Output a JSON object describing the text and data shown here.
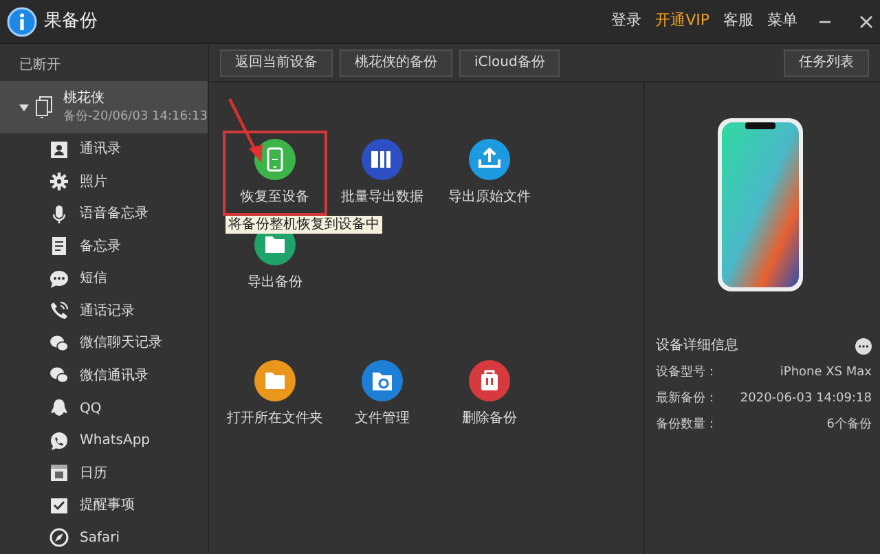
{
  "app": {
    "title": "果备份"
  },
  "header_links": [
    {
      "label": "登录",
      "highlighted": false
    },
    {
      "label": "开通VIP",
      "highlighted": true
    },
    {
      "label": "客服",
      "highlighted": false
    },
    {
      "label": "菜单",
      "highlighted": false
    }
  ],
  "toolbar": {
    "buttons": [
      "返回当前设备",
      "桃花侠的备份",
      "iCloud备份"
    ],
    "task_button": "任务列表"
  },
  "sidebar": {
    "status": "已断开",
    "device": {
      "name": "桃花侠",
      "subtitle": "备份-20/06/03 14:16:13",
      "selected": true,
      "expanded": true
    },
    "items": [
      {
        "label": "通讯录",
        "kind": "contacts"
      },
      {
        "label": "照片",
        "kind": "photos"
      },
      {
        "label": "语音备忘录",
        "kind": "mic"
      },
      {
        "label": "备忘录",
        "kind": "notes"
      },
      {
        "label": "短信",
        "kind": "chat"
      },
      {
        "label": "通话记录",
        "kind": "phone"
      },
      {
        "label": "微信聊天记录",
        "kind": "wechat"
      },
      {
        "label": "微信通讯录",
        "kind": "wechat"
      },
      {
        "label": "QQ",
        "kind": "qq"
      },
      {
        "label": "WhatsApp",
        "kind": "whatsapp"
      },
      {
        "label": "日历",
        "kind": "calendar"
      },
      {
        "label": "提醒事项",
        "kind": "reminder"
      },
      {
        "label": "Safari",
        "kind": "safari"
      }
    ]
  },
  "actions": [
    {
      "label": "恢复至设备",
      "kind": "phone",
      "color": "#3cb44a",
      "selected": true
    },
    {
      "label": "批量导出数据",
      "kind": "export",
      "color": "#2d4fc4",
      "selected": false
    },
    {
      "label": "导出原始文件",
      "kind": "upload",
      "color": "#1e9be0",
      "selected": false
    },
    {
      "label": "导出备份",
      "kind": "folder",
      "color": "#1fa36b",
      "selected": false
    },
    {
      "label": "打开所在文件夹",
      "kind": "folder",
      "color": "#e8961c",
      "selected": false
    },
    {
      "label": "文件管理",
      "kind": "gear",
      "color": "#1e7fd6",
      "selected": false
    },
    {
      "label": "删除备份",
      "kind": "bag",
      "color": "#d63a3e",
      "selected": false
    }
  ],
  "tooltip": "将备份整机恢复到设备中",
  "details": {
    "title": "设备详细信息",
    "rows": [
      {
        "label": "设备型号：",
        "value": "iPhone XS Max"
      },
      {
        "label": "最新备份：",
        "value": "2020-06-03 14:09:18"
      },
      {
        "label": "备份数量：",
        "value": "6个备份"
      }
    ]
  }
}
